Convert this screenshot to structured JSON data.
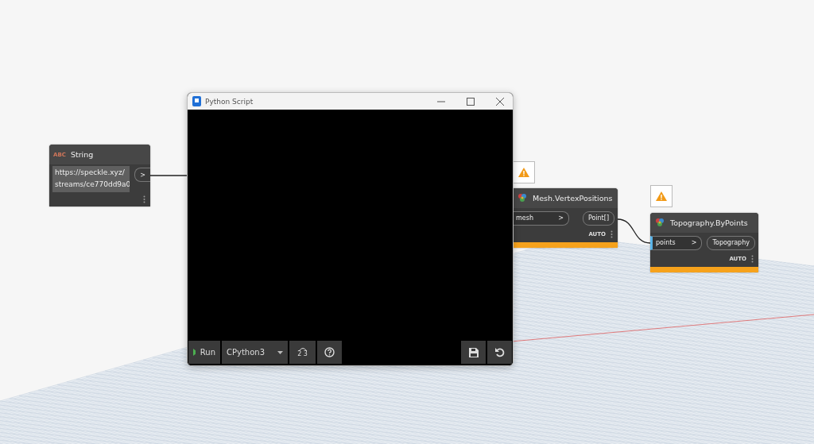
{
  "string_node": {
    "type_label": "ABC",
    "title": "String",
    "value": "https://speckle.xyz/\nstreams/ce770dd9a0",
    "output": ">"
  },
  "python_window": {
    "title": "Python Script",
    "run": "Run",
    "engine": "CPython3",
    "numbering": "2 3"
  },
  "nodes": [
    {
      "title": "Mesh.VertexPositions",
      "warning": true,
      "input": {
        "label": "mesh",
        "arrow": ">",
        "connected": false
      },
      "output": "Point[]",
      "lacing": "AUTO"
    },
    {
      "title": "Topography.ByPoints",
      "warning": true,
      "input": {
        "label": "points",
        "arrow": ">",
        "connected": true
      },
      "output": "Topography",
      "lacing": "AUTO"
    }
  ]
}
